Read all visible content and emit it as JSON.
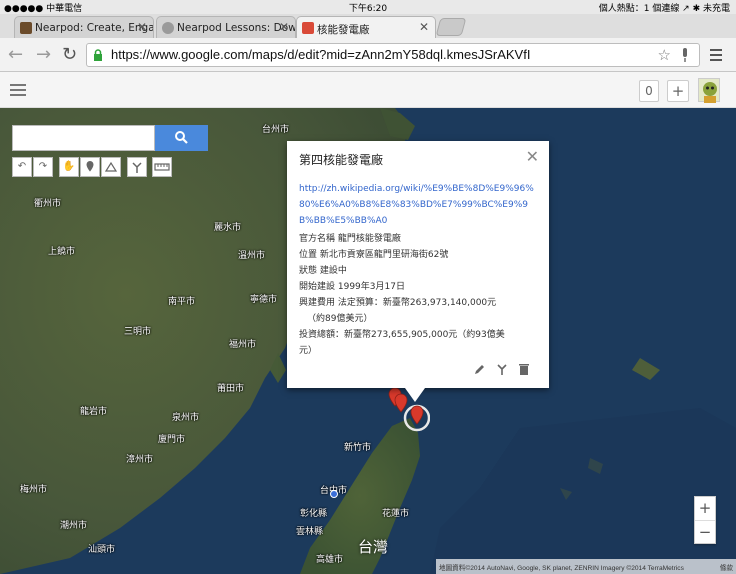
{
  "status_bar": {
    "carrier": "●●●●● 中華電信 ",
    "time": "下午6:20",
    "right": "個人熱點：1 個連線  ↗ ✱ 未充電"
  },
  "tabs": [
    {
      "title": "Nearpod: Create, Engage",
      "favicon_color": "#6b4b2a",
      "active": false
    },
    {
      "title": "Nearpod Lessons: Downl",
      "favicon_color": "#9a9a9a",
      "active": false
    },
    {
      "title": "核能發電廠",
      "favicon_color": "#d94a38",
      "active": true
    }
  ],
  "tab_close": "✕",
  "toolbar": {
    "url": "https://www.google.com/maps/d/edit?mid=zAnn2mY58dql.kmesJSrAKVfI",
    "back_icon": "←",
    "forward_icon": "→",
    "reload_icon": "↻",
    "star_icon": "☆"
  },
  "maps_header": {
    "counter": "0",
    "add_label": "+"
  },
  "map_labels": [
    {
      "text": "衢州市",
      "pos": "a"
    },
    {
      "text": "上饒市",
      "pos": "b"
    },
    {
      "text": "台州市",
      "pos": "c"
    },
    {
      "text": "麗水市",
      "pos": "d"
    },
    {
      "text": "溫州市",
      "pos": "e"
    },
    {
      "text": "南平市",
      "pos": "f"
    },
    {
      "text": "寧德市",
      "pos": "g"
    },
    {
      "text": "三明市",
      "pos": "h"
    },
    {
      "text": "福州市",
      "pos": "i"
    },
    {
      "text": "莆田市",
      "pos": "j"
    },
    {
      "text": "龍岩市",
      "pos": "k"
    },
    {
      "text": "泉州市",
      "pos": "l"
    },
    {
      "text": "廈門市",
      "pos": "m"
    },
    {
      "text": "漳州市",
      "pos": "n"
    },
    {
      "text": "汕頭市",
      "pos": "o"
    },
    {
      "text": "潮州市",
      "pos": "p"
    },
    {
      "text": "梅州市",
      "pos": "q"
    },
    {
      "text": "新竹市",
      "pos": "r"
    },
    {
      "text": "台中市",
      "pos": "s"
    },
    {
      "text": "花蓮市",
      "pos": "t"
    },
    {
      "text": "雲林縣",
      "pos": "u"
    },
    {
      "text": "高雄市",
      "pos": "v"
    },
    {
      "text": "彰化縣",
      "pos": "w"
    },
    {
      "text": "台灣",
      "pos": "big"
    }
  ],
  "info_window": {
    "title": "第四核能發電廠",
    "close": "✕",
    "link": "http://zh.wikipedia.org/wiki/%E9%BE%8D%E9%96%80%E6%A0%B8%E8%83%BD%E7%99%BC%E9%9B%BB%E5%BB%A0",
    "rows": [
      "官方名稱 龍門核能發電廠",
      "位置 新北市貢寮區龍門里研海街62號",
      "狀態 建設中",
      "開始建設 1999年3月17日",
      "興建費用 法定預算：新臺幣263,973,140,000元",
      "（約89億美元）",
      "投資總額：新臺幣273,655,905,000元（約93億美",
      "元）"
    ]
  },
  "zoom": {
    "in": "+",
    "out": "−"
  },
  "attribution": {
    "text": "地圖資料©2014 AutoNavi, Google, SK planet, ZENRIN Imagery ©2014 TerraMetrics",
    "terms": "條款"
  },
  "colors": {
    "sea": "#1d3b5e",
    "land": "#4d5b37",
    "marker": "#d9392b",
    "search_button": "#4a89dc",
    "link": "#3366cc"
  }
}
